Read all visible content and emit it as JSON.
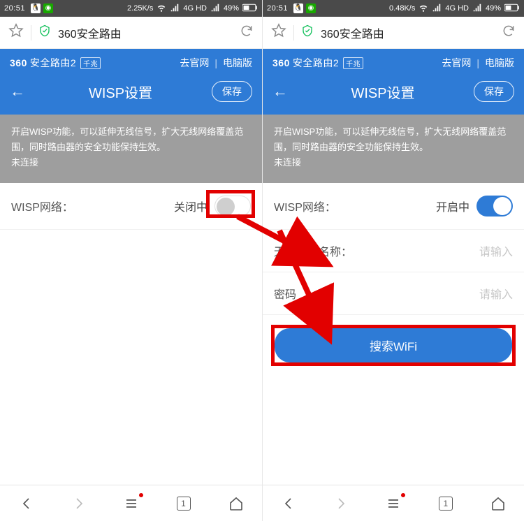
{
  "statusbar": {
    "time": "20:51",
    "speed_left": "2.25K/s",
    "speed_right": "0.48K/s",
    "net": "4G HD",
    "battery": "49%"
  },
  "browser": {
    "title": "360安全路由"
  },
  "banner": {
    "logo_360": "360",
    "logo_cn": "安全路由2",
    "chip": "千兆",
    "link_site": "去官网",
    "link_pc": "电脑版",
    "title": "WISP设置",
    "save": "保存"
  },
  "help": {
    "line1": "开启WISP功能，可以延伸无线信号，扩大无线网络覆盖范围，同时路由器的安全功能保持生效。",
    "line2": "未连接"
  },
  "wisp": {
    "label": "WISP网络：",
    "status_off": "关闭中",
    "status_on": "开启中"
  },
  "fields": {
    "ssid_label": "无线网络名称：",
    "pwd_label": "密码",
    "placeholder": "请输入"
  },
  "search_btn": "搜索WiFi",
  "bottomnav": {
    "tab_count": "1"
  }
}
